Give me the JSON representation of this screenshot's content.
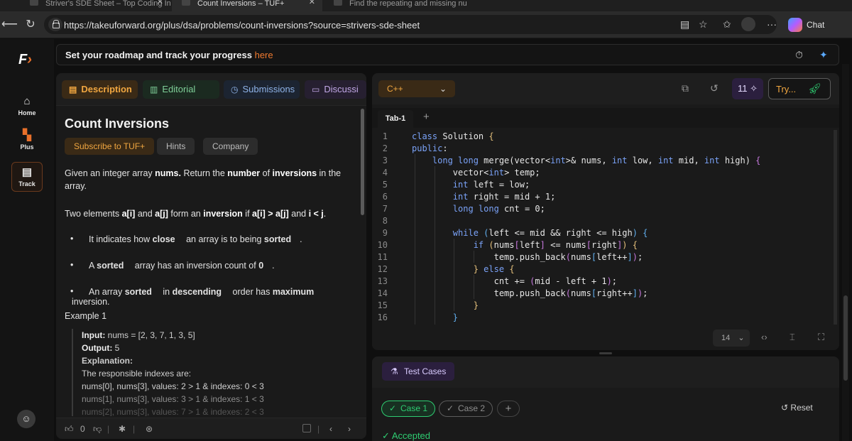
{
  "browser": {
    "tabs": [
      {
        "title": "Striver's SDE Sheet – Top Coding In"
      },
      {
        "title": "Count Inversions – TUF+"
      },
      {
        "title": "Find the repeating and missing nu"
      }
    ],
    "url": "https://takeuforward.org/plus/dsa/problems/count-inversions?source=strivers-sde-sheet",
    "chat_label": "Chat"
  },
  "sidebar": {
    "items": [
      {
        "label": "Home",
        "icon": "home-icon"
      },
      {
        "label": "Plus",
        "icon": "plus-grid-icon"
      },
      {
        "label": "Track",
        "icon": "document-icon"
      }
    ]
  },
  "banner": {
    "text": "Set your roadmap and track your progress",
    "link": "here"
  },
  "problem": {
    "tabs": [
      "Description",
      "Editorial",
      "Submissions",
      "Discussi"
    ],
    "title": "Count Inversions",
    "subscribe_label": "Subscribe to TUF+",
    "hints_label": "Hints",
    "company_label": "Company",
    "para1": {
      "a": "Given an integer array ",
      "b": "nums.",
      "c": " Return the ",
      "d": "number",
      "e": " of ",
      "f": "inversions",
      "g": " in the array."
    },
    "para2": {
      "a": "Two elements ",
      "b": "a[i]",
      "c": " and ",
      "d": "a[j]",
      "e": " form an ",
      "f": "inversion",
      "g": " if ",
      "h": "a[i] > a[j]",
      "i": " and ",
      "j": "i < j",
      "k": "."
    },
    "bullets": [
      {
        "a": "It indicates how ",
        "b": "close",
        "c": " an array is to being ",
        "d": "sorted",
        "e": "."
      },
      {
        "a": "A ",
        "b": "sorted",
        "c": " array has an inversion count of ",
        "d": "0",
        "e": "."
      },
      {
        "a": "An array ",
        "b": "sorted",
        "c": " in ",
        "d": "descending",
        "e": " order has ",
        "f": "maximum",
        "g": " inversion."
      }
    ],
    "example_title": "Example 1",
    "example": {
      "input_label": "Input:",
      "input_value": " nums = [2, 3, 7, 1, 3, 5]",
      "output_label": "Output:",
      "output_value": " 5",
      "explanation_label": "Explanation:",
      "lines": [
        "The responsible indexes are:",
        "nums[0], nums[3], values: 2 > 1 & indexes: 0 < 3",
        "nums[1], nums[3], values: 3 > 1 & indexes: 1 < 3",
        "nums[2], nums[3], values: 7 > 1 & indexes: 2 < 3"
      ]
    },
    "likes": "0"
  },
  "editor": {
    "language": "C++",
    "badge_count": "11",
    "try_label": "Try...",
    "tab_label": "Tab-1",
    "font_size": "14",
    "line_numbers": [
      "1",
      "2",
      "3",
      "4",
      "5",
      "6",
      "7",
      "8",
      "9",
      "10",
      "11",
      "12",
      "13",
      "14",
      "15",
      "16"
    ]
  },
  "tests": {
    "header_label": "Test Cases",
    "case1": "Case 1",
    "case2": "Case 2",
    "reset_label": "Reset",
    "status": "Accepted"
  },
  "colors": {
    "accent": "#f0a640",
    "brand": "#f07a2f",
    "success": "#2ecc71"
  }
}
